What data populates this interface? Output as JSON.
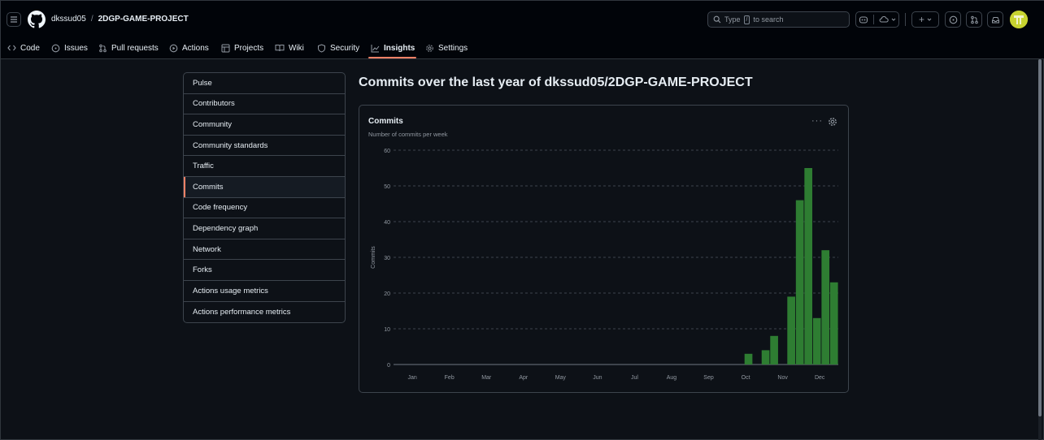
{
  "header": {
    "owner": "dkssud05",
    "separator": "/",
    "repo": "2DGP-GAME-PROJECT",
    "search_prefix": "Type",
    "search_key": "/",
    "search_suffix": "to search",
    "plus_label": "+"
  },
  "tabs": [
    {
      "label": "Code",
      "icon": "code-icon"
    },
    {
      "label": "Issues",
      "icon": "issue-icon"
    },
    {
      "label": "Pull requests",
      "icon": "pull-request-icon"
    },
    {
      "label": "Actions",
      "icon": "play-icon"
    },
    {
      "label": "Projects",
      "icon": "table-icon"
    },
    {
      "label": "Wiki",
      "icon": "book-icon"
    },
    {
      "label": "Security",
      "icon": "shield-icon"
    },
    {
      "label": "Insights",
      "icon": "graph-icon",
      "active": true
    },
    {
      "label": "Settings",
      "icon": "gear-icon"
    }
  ],
  "sidebar": {
    "items": [
      {
        "label": "Pulse"
      },
      {
        "label": "Contributors"
      },
      {
        "label": "Community"
      },
      {
        "label": "Community standards"
      },
      {
        "label": "Traffic"
      },
      {
        "label": "Commits",
        "active": true
      },
      {
        "label": "Code frequency"
      },
      {
        "label": "Dependency graph"
      },
      {
        "label": "Network"
      },
      {
        "label": "Forks"
      },
      {
        "label": "Actions usage metrics"
      },
      {
        "label": "Actions performance metrics"
      }
    ]
  },
  "main": {
    "title_prefix": "Commits over the last year of",
    "title_repo": "dkssud05/2DGP-GAME-PROJECT",
    "card_title": "Commits",
    "card_subtitle": "Number of commits per week",
    "more_label": "···"
  },
  "colors": {
    "bar": "#2e7d32",
    "accent": "#f78166",
    "grid": "#3d444d",
    "axis_text": "#9198a1"
  },
  "chart_data": {
    "type": "bar",
    "title": "Commits",
    "subtitle": "Number of commits per week",
    "ylabel": "Commits",
    "xlabel": "",
    "ylim": [
      0,
      60
    ],
    "yticks": [
      0,
      10,
      20,
      30,
      40,
      50,
      60
    ],
    "month_labels": [
      "Jan",
      "Feb",
      "Mar",
      "Apr",
      "May",
      "Jun",
      "Jul",
      "Aug",
      "Sep",
      "Oct",
      "Nov",
      "Dec"
    ],
    "weeks_per_month_label": 4.33,
    "values": [
      0,
      0,
      0,
      0,
      0,
      0,
      0,
      0,
      0,
      0,
      0,
      0,
      0,
      0,
      0,
      0,
      0,
      0,
      0,
      0,
      0,
      0,
      0,
      0,
      0,
      0,
      0,
      0,
      0,
      0,
      0,
      0,
      0,
      0,
      0,
      0,
      0,
      0,
      0,
      0,
      0,
      3,
      0,
      4,
      8,
      0,
      19,
      46,
      55,
      13,
      32,
      23
    ],
    "grid": true,
    "legend": "none"
  }
}
